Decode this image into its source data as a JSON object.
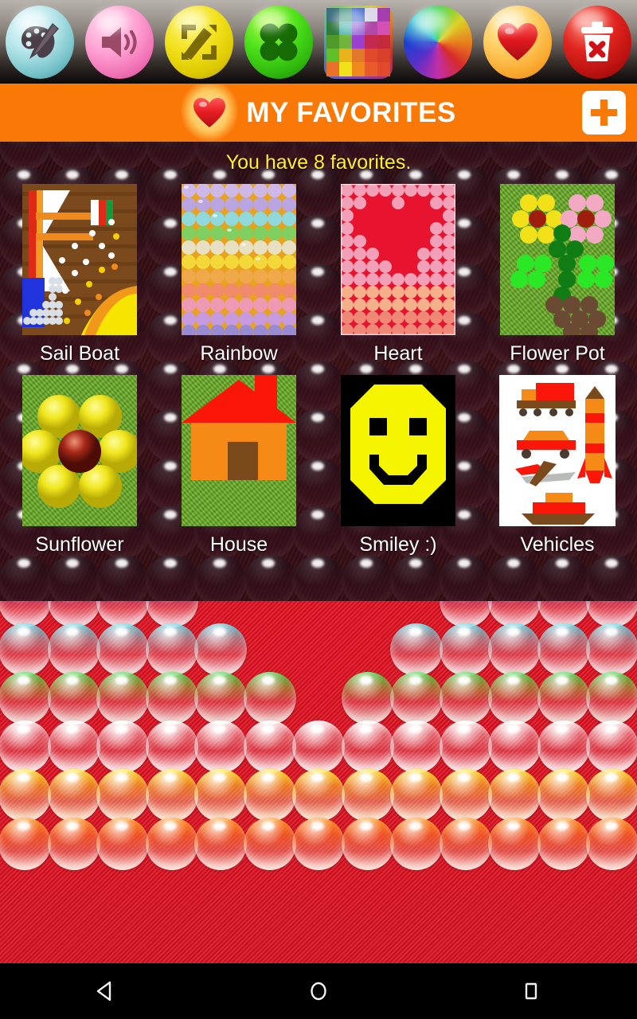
{
  "toolbar": {
    "items": [
      {
        "name": "palette-icon",
        "label": "Palette"
      },
      {
        "name": "sound-icon",
        "label": "Sound"
      },
      {
        "name": "resize-icon",
        "label": "Resize"
      },
      {
        "name": "bead-size-icon",
        "label": "Bead Size"
      },
      {
        "name": "color-grid-icon",
        "label": "Colors"
      },
      {
        "name": "color-wheel-icon",
        "label": "Color Wheel"
      },
      {
        "name": "favorites-icon",
        "label": "Favorites"
      },
      {
        "name": "trash-icon",
        "label": "Clear"
      }
    ]
  },
  "header": {
    "title": "MY FAVORITES",
    "heart_icon": "heart-icon",
    "add_button": {
      "icon": "plus-icon",
      "label": "Add"
    },
    "bg_color": "#fa7806"
  },
  "panel": {
    "count_text": "You have 8 favorites.",
    "count_color": "#ffef2e",
    "favorites": [
      {
        "label": "Sail Boat"
      },
      {
        "label": "Rainbow"
      },
      {
        "label": "Heart"
      },
      {
        "label": "Flower Pot"
      },
      {
        "label": "Sunflower"
      },
      {
        "label": "House"
      },
      {
        "label": "Smiley :)"
      },
      {
        "label": "Vehicles"
      }
    ]
  },
  "board": {
    "bg_color": "#e8152a",
    "bead_colors": [
      "purple",
      "cyan",
      "green",
      "white",
      "yellow",
      "orange"
    ]
  },
  "navbar": {
    "buttons": [
      {
        "name": "nav-back-button",
        "glyph": "back-triangle-icon"
      },
      {
        "name": "nav-home-button",
        "glyph": "home-circle-icon"
      },
      {
        "name": "nav-recents-button",
        "glyph": "recents-square-icon"
      }
    ]
  }
}
